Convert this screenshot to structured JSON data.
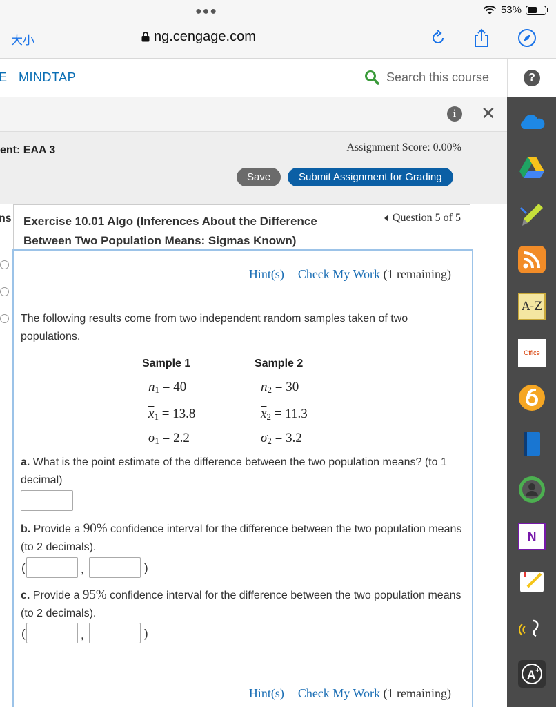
{
  "browser": {
    "font_size_label": "大小",
    "url": "ng.cengage.com",
    "battery": "53%"
  },
  "header": {
    "brand_fragment": "E",
    "brand": "MINDTAP",
    "search_placeholder": "Search this course",
    "help_label": "?"
  },
  "toolbar": {
    "info_label": "i",
    "close_label": "✕"
  },
  "assignment": {
    "title": "ent: EAA 3",
    "score": "Assignment Score: 0.00%",
    "save_label": "Save",
    "submit_label": "Submit Assignment for Grading"
  },
  "sidebar": {
    "label_fragment": "ns"
  },
  "question": {
    "title": "Exercise 10.01 Algo (Inferences About the Difference Between Two Population Means: Sigmas Known)",
    "nav": "Question 5 of 5",
    "hint_label": "Hint(s)",
    "check_label": "Check My Work",
    "remaining": "(1 remaining)",
    "intro": "The following results come from two independent random samples taken of two populations.",
    "sample1_head": "Sample 1",
    "sample2_head": "Sample 2",
    "n1": "40",
    "n2": "30",
    "x1": "13.8",
    "x2": "11.3",
    "s1": "2.2",
    "s2": "3.2",
    "a_label": "a.",
    "a_text": "What is the point estimate of the difference between the two population means? (to 1 decimal)",
    "b_label": "b.",
    "b_pre": "Provide a",
    "b_conf": "90%",
    "b_post": "confidence interval for the difference between the two population means (to 2 decimals).",
    "c_label": "c.",
    "c_pre": "Provide a",
    "c_conf": "95%",
    "c_post": "confidence interval for the difference between the two population means (to 2 decimals).",
    "open_paren": "(",
    "comma": ",",
    "close_paren": ")"
  },
  "rail": {
    "icons": [
      "onedrive-icon",
      "google-drive-icon",
      "highlighter-icon",
      "rss-icon",
      "a-z-icon",
      "office-icon",
      "chegg-icon",
      "book-icon",
      "avatar-icon",
      "onenote-icon",
      "notes-icon",
      "audio-icon",
      "grade-icon"
    ],
    "az_label": "A-Z",
    "office_label": "Office",
    "onenote_label": "N"
  },
  "colors": {
    "brand_blue": "#0a6eb4",
    "submit_blue": "#0b5fa5",
    "link_blue": "#1c6fb5",
    "rail_bg": "#4a4a4a"
  }
}
